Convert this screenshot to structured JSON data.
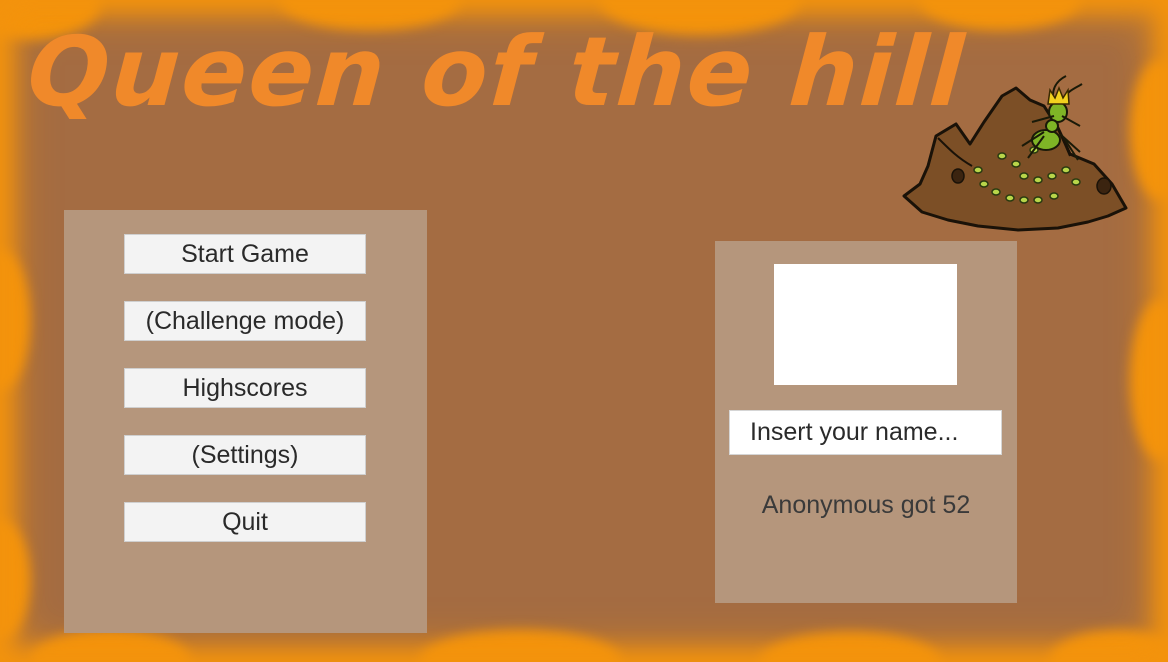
{
  "game": {
    "title": "Queen of the hill",
    "accent_color": "#f4940c",
    "background_color": "#a46c42",
    "panel_color": "#b5967c"
  },
  "menu": {
    "buttons": [
      {
        "label": "Start Game"
      },
      {
        "label": "(Challenge mode)"
      },
      {
        "label": "Highscores"
      },
      {
        "label": "(Settings)"
      },
      {
        "label": "Quit"
      }
    ]
  },
  "score_panel": {
    "name_placeholder": "Insert your name...",
    "result_text": "Anonymous got 52"
  },
  "illustration": {
    "icon": "anthill-queen-ant-icon"
  }
}
